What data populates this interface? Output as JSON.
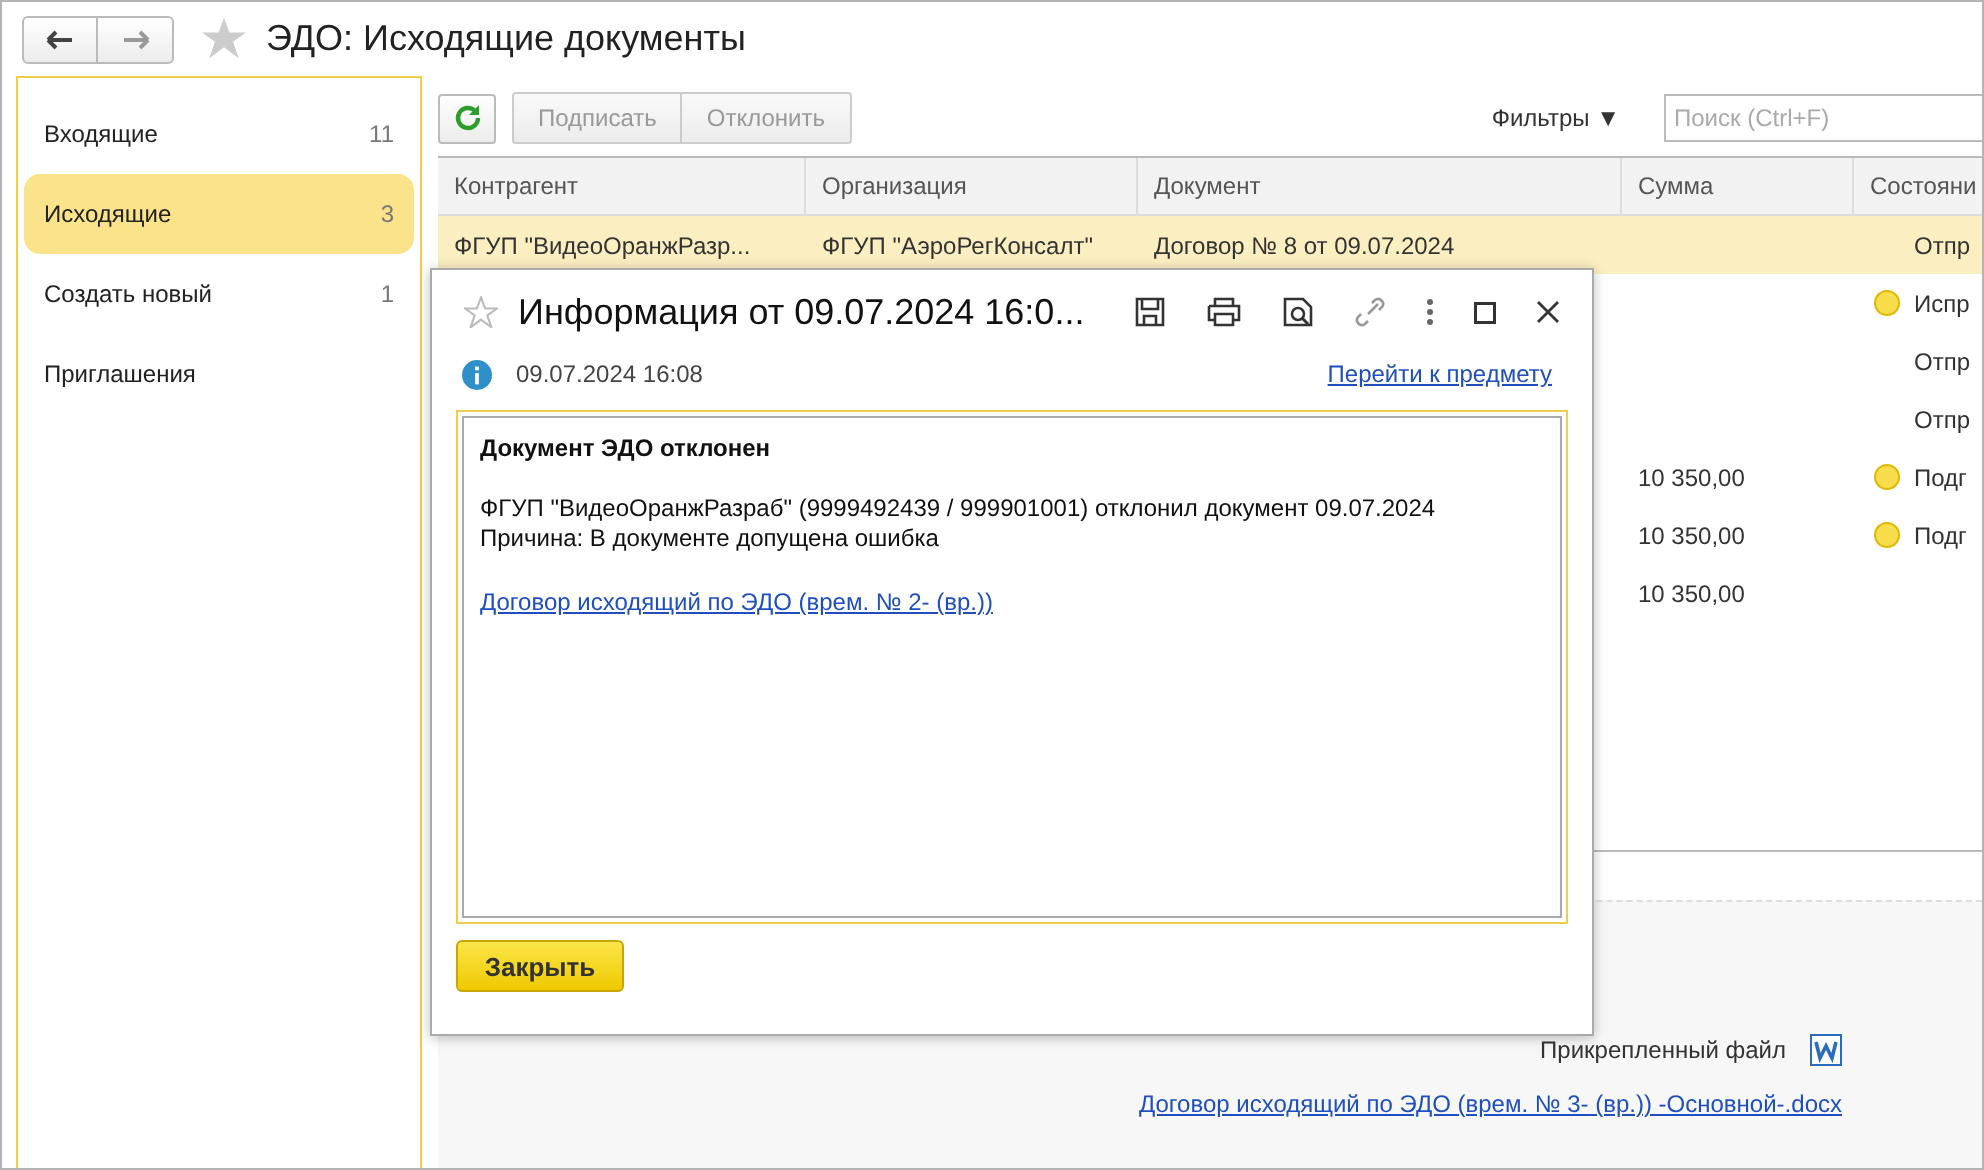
{
  "window": {
    "title": "ЭДО: Исходящие документы"
  },
  "sidebar": {
    "items": [
      {
        "label": "Входящие",
        "count": "11",
        "selected": false
      },
      {
        "label": "Исходящие",
        "count": "3",
        "selected": true
      },
      {
        "label": "Создать новый",
        "count": "1",
        "selected": false
      },
      {
        "label": "Приглашения",
        "selected": false
      }
    ]
  },
  "toolbar": {
    "buttons": [
      "Подписать",
      "Отклонить"
    ],
    "filters": "Фильтры ▼",
    "search": {
      "placeholder": "Поиск (Ctrl+F)"
    }
  },
  "table": {
    "columns": [
      "Контрагент",
      "Организация",
      "Документ",
      "Сумма",
      "Состояни"
    ],
    "rows": [
      {
        "cells": [
          "ФГУП \"ВидеоОранжРазр...",
          "ФГУП \"АэроРегКонсалт\"",
          "Договор № 8 от 09.07.2024",
          "",
          "Отпр"
        ],
        "dot": false,
        "selected": true
      },
      {
        "cells": [
          "",
          "",
          "",
          "",
          "Испр"
        ],
        "dot": true,
        "selected": false
      },
      {
        "cells": [
          "",
          "",
          "",
          "",
          "Отпр"
        ],
        "dot": false,
        "selected": false
      },
      {
        "cells": [
          "",
          "",
          "",
          "",
          "Отпр"
        ],
        "dot": false,
        "selected": false
      },
      {
        "cells": [
          "",
          "",
          "",
          "10 350,00",
          "Подг"
        ],
        "dot": true,
        "selected": false
      },
      {
        "cells": [
          "",
          "",
          "",
          "10 350,00",
          "Подг"
        ],
        "dot": true,
        "selected": false
      },
      {
        "cells": [
          "",
          "",
          "",
          "10 350,00",
          ""
        ],
        "dot": false,
        "selected": false
      }
    ]
  },
  "details": {
    "attachment_label": "Прикрепленный файл",
    "attachment_link": "Договор исходящий по ЭДО (врем. № 3- (вр.)) -Основной-.docx"
  },
  "dialog": {
    "title": "Информация от 09.07.2024 16:0...",
    "date": "09.07.2024 16:08",
    "goto_link": "Перейти к предмету",
    "heading": "Документ ЭДО отклонен",
    "lines": [
      "ФГУП \"ВидеоОранжРазраб\" (9999492439 / 999901001) отклонил документ 09.07.2024",
      "Причина: В документе допущена ошибка"
    ],
    "link": "Договор исходящий по ЭДО (врем. № 2- (вр.))",
    "close_button": "Закрыть"
  }
}
